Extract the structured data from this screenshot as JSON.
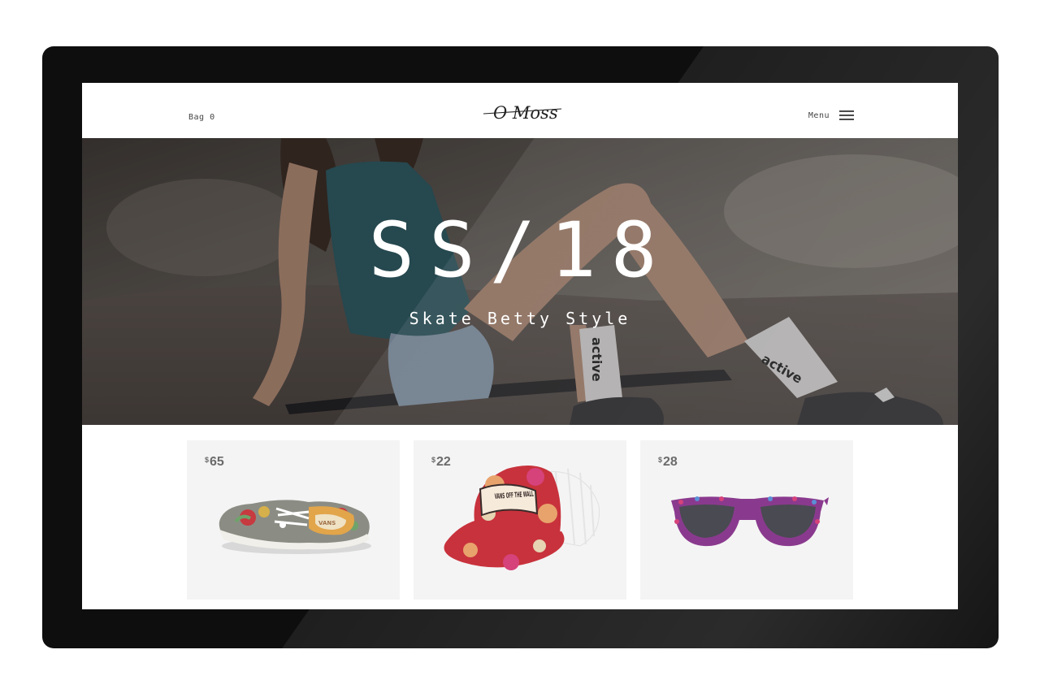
{
  "header": {
    "bag_label": "Bag 0",
    "logo_text": "O Moss",
    "menu_label": "Menu"
  },
  "hero": {
    "title": "SS/18",
    "subtitle": "Skate Betty Style",
    "sock_brand": "active"
  },
  "products": [
    {
      "currency": "$",
      "price": "65",
      "icon": "sneaker",
      "print_text": "VANS"
    },
    {
      "currency": "$",
      "price": "22",
      "icon": "trucker-cap",
      "print_text": "VANS OFF THE WALL"
    },
    {
      "currency": "$",
      "price": "28",
      "icon": "sunglasses"
    }
  ],
  "colors": {
    "frame": "#0e0e0e",
    "card_bg": "#f4f4f4",
    "price": "#6b6b6b",
    "floral_red": "#c8323c",
    "floral_pink": "#d6427a",
    "lens": "#4a4a52"
  }
}
